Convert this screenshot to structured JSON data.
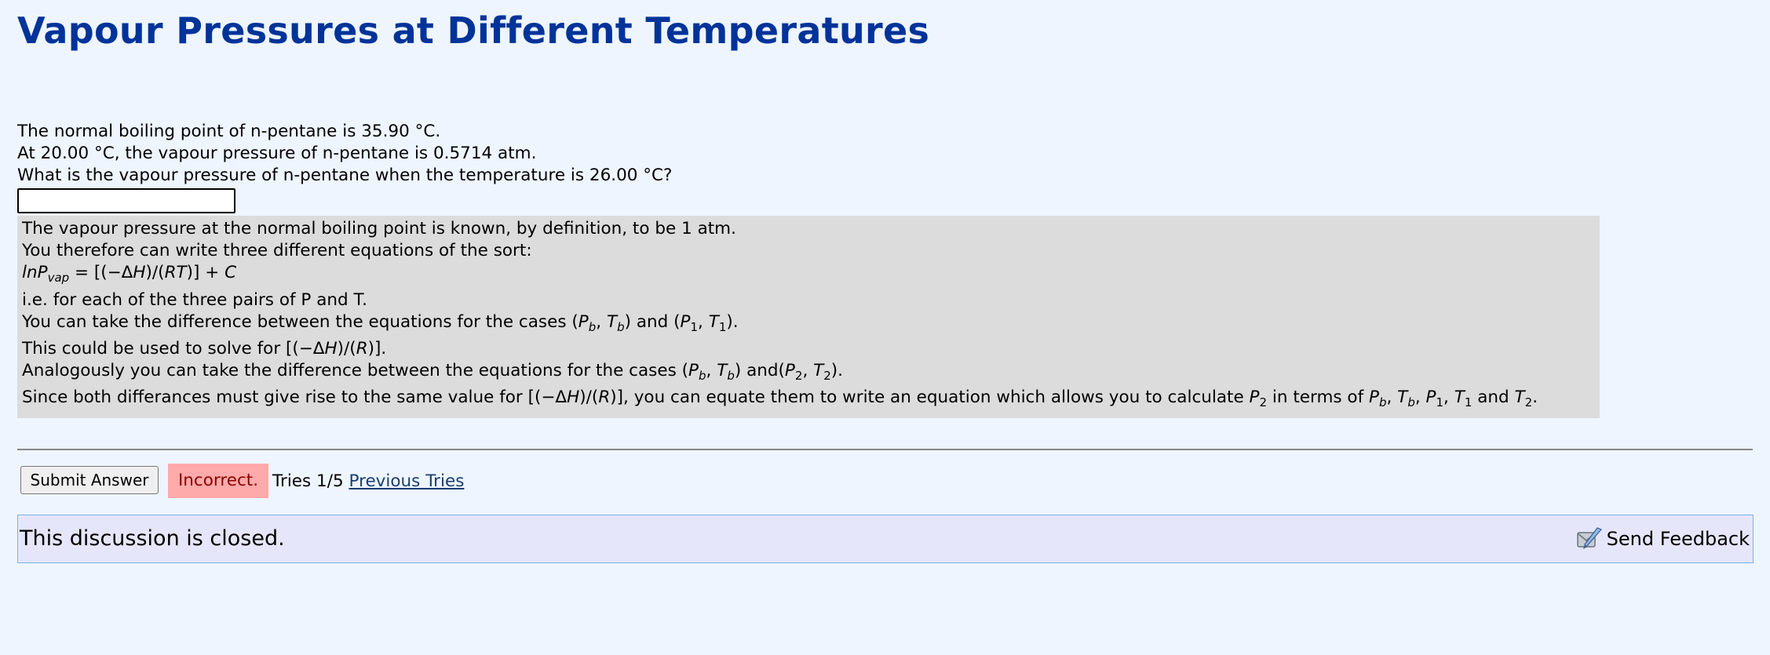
{
  "page": {
    "title": "Vapour Pressures at Different Temperatures"
  },
  "problem": {
    "line1": "The normal boiling point of n-pentane is 35.90 °C.",
    "line2": "At 20.00 °C, the vapour pressure of n-pentane is 0.5714 atm.",
    "line3": "What is the vapour pressure of n-pentane when the temperature is 26.00 °C?"
  },
  "answer": {
    "value": ""
  },
  "hint": {
    "line1": "The vapour pressure at the normal boiling point is known, by definition, to be 1 atm.",
    "line2": "You therefore can write three different equations of the sort:",
    "eq_ln": "lnP",
    "eq_ln_sub": "vap",
    "eq_rest_a": " = [(−Δ",
    "eq_H": "H",
    "eq_rest_b": ")/(",
    "eq_RT": "RT",
    "eq_rest_c": ")] + ",
    "eq_C": "C",
    "line4": "i.e. for each of the three pairs of P and T.",
    "line5_a": "You can take the difference between the equations for the cases (",
    "line5_b": ") and (",
    "line5_c": ").",
    "line6_a": "This could be used to solve for [(−Δ",
    "line6_b": ")/(",
    "line6_c": ")].",
    "line7_a": "Analogously you can take the difference between the equations for the cases (",
    "line7_b": ") and(",
    "line7_c": ").",
    "line8_a": "Since both differances must give rise to the same value for [(−Δ",
    "line8_b": ")/(",
    "line8_c": ")], you can equate them to write an equation which allows you to calculate ",
    "line8_d": " in terms of ",
    "line8_e": " and ",
    "line8_f": ".",
    "sym_P": "P",
    "sym_T": "T",
    "sym_H": "H",
    "sym_R": "R",
    "sub_b": "b",
    "sub_1": "1",
    "sub_2": "2",
    "comma": ", "
  },
  "actions": {
    "submit_label": "Submit Answer",
    "status": "Incorrect.",
    "tries": "Tries 1/5",
    "previous_tries": "Previous Tries"
  },
  "discussion": {
    "closed_text": "This discussion is closed.",
    "feedback_label": "Send Feedback",
    "feedback_icon": "feedback-icon"
  },
  "colors": {
    "background": "#eef5ff",
    "title": "#003399",
    "hint_background": "#dcdcdc",
    "incorrect_background": "#ffaaaa",
    "discussion_background": "#e6e6fa"
  }
}
